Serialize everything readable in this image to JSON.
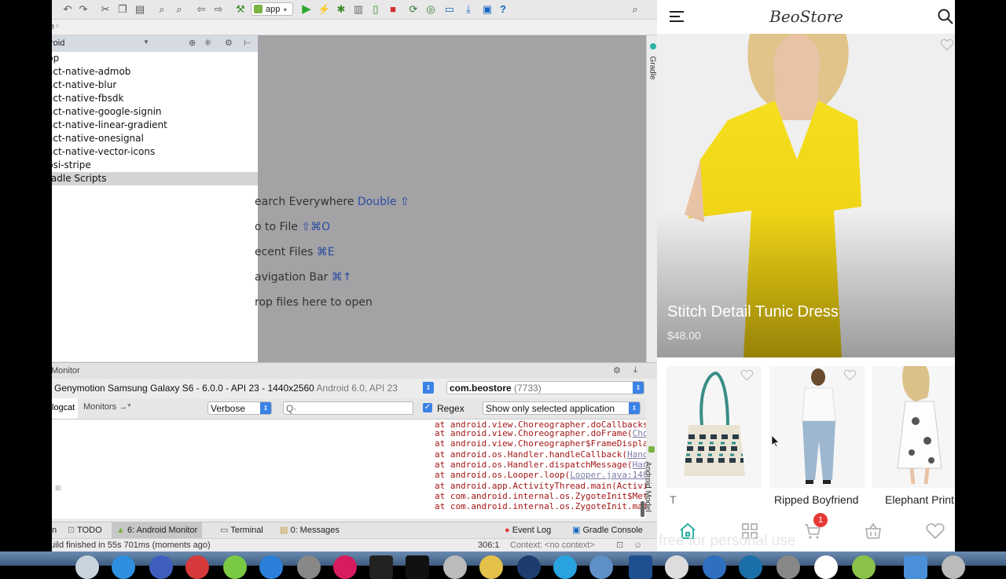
{
  "ide": {
    "run_config": "app",
    "breadcrumb": "e",
    "project_view": "roid",
    "tree_items": [
      {
        "label": "pp"
      },
      {
        "label": "act-native-admob"
      },
      {
        "label": "act-native-blur"
      },
      {
        "label": "act-native-fbsdk"
      },
      {
        "label": "act-native-google-signin"
      },
      {
        "label": "act-native-linear-gradient"
      },
      {
        "label": "act-native-onesignal"
      },
      {
        "label": "act-native-vector-icons"
      },
      {
        "label": "psi-stripe"
      },
      {
        "label": "radle Scripts"
      }
    ],
    "editor_hints": [
      {
        "text": "earch Everywhere",
        "key": "Double ⇧"
      },
      {
        "text": "o to File",
        "key": "⇧⌘O"
      },
      {
        "text": "ecent Files",
        "key": "⌘E"
      },
      {
        "text": "avigation Bar",
        "key": "⌘↑"
      },
      {
        "text": "rop files here to open",
        "key": ""
      }
    ],
    "gradle_label": "Gradle",
    "android_model_label": "Android Model",
    "monitor_title": "Monitor",
    "device_name": "Genymotion Samsung Galaxy S6 - 6.0.0 - API 23 - 1440x2560",
    "device_os": "Android 6.0, API 23",
    "process_name": "com.beostore",
    "process_id": "(7733)",
    "tab_logcat": "logcat",
    "tab_monitors": "Monitors",
    "tab_monitors_suffix": "→*",
    "log_level": "Verbose",
    "search_placeholder": "Q·",
    "regex_label": "Regex",
    "filter_option": "Show only selected application",
    "log_lines": [
      {
        "text": "at android.view.Choreographer.doCallbacks(",
        "link": "Ch"
      },
      {
        "text": "at android.view.Choreographer.doFrame(",
        "link": "Chored"
      },
      {
        "text": "at android.view.Choreographer$FrameDisplayEv",
        "link": ""
      },
      {
        "text": "at android.os.Handler.handleCallback(",
        "link": "Handler"
      },
      {
        "text": "at android.os.Handler.dispatchMessage(",
        "link": "Handle"
      },
      {
        "text": "at android.os.Looper.loop(",
        "link": "Looper.java:148)"
      },
      {
        "text": "at android.app.ActivityThread.main(Activity",
        "link": ""
      },
      {
        "text": "at com.android.internal.os.ZygoteInit$Method",
        "link": ""
      },
      {
        "text": "at com.android.internal.os.ZygoteInit.main(",
        "link": ""
      }
    ],
    "bottom_tabs": {
      "run": "n",
      "todo": "TODO",
      "android_monitor": "6: Android Monitor",
      "terminal": "Terminal",
      "messages": "0: Messages",
      "event_log": "Event Log",
      "gradle_console": "Gradle Console"
    },
    "status_text": "uild finished in 55s 701ms (moments ago)",
    "cursor_pos": "306:1",
    "context": "Context: <no context>"
  },
  "app": {
    "title": "BeoStore",
    "hero_product": {
      "name": "Stitch Detail Tunic Dress",
      "price": "$48.00"
    },
    "products": [
      {
        "name": "T"
      },
      {
        "name": "Ripped Boyfriend"
      },
      {
        "name": "Elephant Print"
      }
    ],
    "cart_badge": "1",
    "watermark": "free for personal use"
  },
  "colors": {
    "accent_teal": "#2bb3a3",
    "badge_red": "#e53935",
    "ide_blue": "#3b82e6"
  }
}
